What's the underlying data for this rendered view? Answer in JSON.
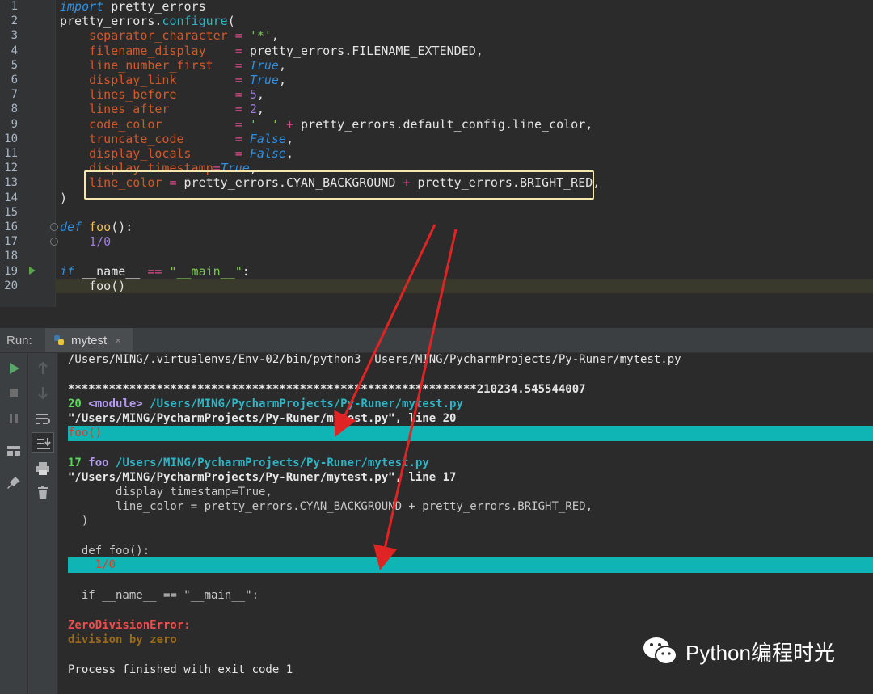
{
  "editor": {
    "line_numbers": [
      "1",
      "2",
      "3",
      "4",
      "5",
      "6",
      "7",
      "8",
      "9",
      "10",
      "11",
      "12",
      "13",
      "14",
      "15",
      "16",
      "17",
      "18",
      "19",
      "20"
    ],
    "lines": [
      [
        {
          "t": "import",
          "c": "kw"
        },
        {
          "t": " pretty_errors",
          "c": ""
        }
      ],
      [
        {
          "t": "pretty_errors.",
          "c": ""
        },
        {
          "t": "configure",
          "c": "teal"
        },
        {
          "t": "(",
          "c": ""
        }
      ],
      [
        {
          "t": "    separator_character ",
          "c": "prm"
        },
        {
          "t": "= ",
          "c": "op"
        },
        {
          "t": "'*'",
          "c": "str"
        },
        {
          "t": ",",
          "c": ""
        }
      ],
      [
        {
          "t": "    filename_display    ",
          "c": "prm"
        },
        {
          "t": "= ",
          "c": "op"
        },
        {
          "t": "pretty_errors.FILENAME_EXTENDED,",
          "c": ""
        }
      ],
      [
        {
          "t": "    line_number_first   ",
          "c": "prm"
        },
        {
          "t": "= ",
          "c": "op"
        },
        {
          "t": "True",
          "c": "kw"
        },
        {
          "t": ",",
          "c": ""
        }
      ],
      [
        {
          "t": "    display_link        ",
          "c": "prm"
        },
        {
          "t": "= ",
          "c": "op"
        },
        {
          "t": "True",
          "c": "kw"
        },
        {
          "t": ",",
          "c": ""
        }
      ],
      [
        {
          "t": "    lines_before        ",
          "c": "prm"
        },
        {
          "t": "= ",
          "c": "op"
        },
        {
          "t": "5",
          "c": "num"
        },
        {
          "t": ",",
          "c": ""
        }
      ],
      [
        {
          "t": "    lines_after         ",
          "c": "prm"
        },
        {
          "t": "= ",
          "c": "op"
        },
        {
          "t": "2",
          "c": "num"
        },
        {
          "t": ",",
          "c": ""
        }
      ],
      [
        {
          "t": "    code_color          ",
          "c": "prm"
        },
        {
          "t": "= ",
          "c": "op"
        },
        {
          "t": "'  '",
          "c": "str"
        },
        {
          "t": " + ",
          "c": "op"
        },
        {
          "t": "pretty_errors.default_config.line_color,",
          "c": ""
        }
      ],
      [
        {
          "t": "    truncate_code       ",
          "c": "prm"
        },
        {
          "t": "= ",
          "c": "op"
        },
        {
          "t": "False",
          "c": "kw"
        },
        {
          "t": ",",
          "c": ""
        }
      ],
      [
        {
          "t": "    display_locals      ",
          "c": "prm"
        },
        {
          "t": "= ",
          "c": "op"
        },
        {
          "t": "False",
          "c": "kw"
        },
        {
          "t": ",",
          "c": ""
        }
      ],
      [
        {
          "t": "    display_timestamp",
          "c": "prm"
        },
        {
          "t": "=",
          "c": "op"
        },
        {
          "t": "True",
          "c": "kw"
        },
        {
          "t": ",",
          "c": ""
        }
      ],
      [
        {
          "t": "    line_color ",
          "c": "prm"
        },
        {
          "t": "= ",
          "c": "op"
        },
        {
          "t": "pretty_errors.CYAN_BACKGROUND ",
          "c": ""
        },
        {
          "t": "+ ",
          "c": "op"
        },
        {
          "t": "pretty_errors.BRIGHT_RED,",
          "c": ""
        }
      ],
      [
        {
          "t": ")",
          "c": ""
        }
      ],
      [
        {
          "t": "",
          "c": ""
        }
      ],
      [
        {
          "t": "def",
          "c": "kw"
        },
        {
          "t": " ",
          "c": ""
        },
        {
          "t": "foo",
          "c": "fn"
        },
        {
          "t": "():",
          "c": ""
        }
      ],
      [
        {
          "t": "    ",
          "c": ""
        },
        {
          "t": "1/0",
          "c": "num"
        }
      ],
      [
        {
          "t": "",
          "c": ""
        }
      ],
      [
        {
          "t": "if",
          "c": "kw"
        },
        {
          "t": " __name__ ",
          "c": ""
        },
        {
          "t": "==",
          "c": "op"
        },
        {
          "t": " ",
          "c": ""
        },
        {
          "t": "\"__main__\"",
          "c": "str"
        },
        {
          "t": ":",
          "c": ""
        }
      ],
      [
        {
          "t": "    ",
          "c": ""
        },
        {
          "t": "foo()",
          "c": ""
        }
      ]
    ]
  },
  "run_panel": {
    "label": "Run:",
    "tab_label": "mytest",
    "tab_close": "×",
    "console": {
      "cmd": "/Users/MING/.virtualenvs/Env-02/bin/python3 /Users/MING/PycharmProjects/Py-Runer/mytest.py",
      "stars": "************************************************************",
      "timestamp": "210234.545544007",
      "frame1_line": "20",
      "frame1_module": "<module>",
      "frame1_path": "/Users/MING/PycharmProjects/Py-Runer/mytest.py",
      "frame1_file": "\"/Users/MING/PycharmProjects/Py-Runer/mytest.py\", line 20",
      "frame1_code": "foo()",
      "frame2_line": "17",
      "frame2_func": "foo",
      "frame2_path": "/Users/MING/PycharmProjects/Py-Runer/mytest.py",
      "frame2_file": "\"/Users/MING/PycharmProjects/Py-Runer/mytest.py\", line 17",
      "ctx1": "       display_timestamp=True,",
      "ctx2": "       line_color = pretty_errors.CYAN_BACKGROUND + pretty_errors.BRIGHT_RED,",
      "ctx3": "  )",
      "ctx4": "  def foo():",
      "ctx5": "    1/0",
      "ctx6": "  if __name__ == \"__main__\":",
      "error_name": "ZeroDivisionError:",
      "error_msg": "division by zero",
      "exit": "Process finished with exit code 1"
    }
  },
  "watermark": {
    "text": "Python编程时光",
    "icon": "wechat-icon"
  },
  "colors": {
    "cyan_highlight": "#0fb5b5",
    "annotation_arrow": "#e02424",
    "annotation_box": "#f5e7b0"
  }
}
